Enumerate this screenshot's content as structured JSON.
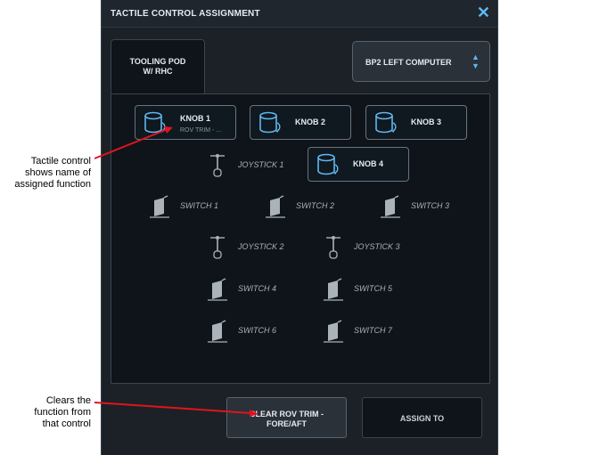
{
  "annotations": {
    "tactile_note": [
      "Tactile control",
      "shows name of",
      "assigned function"
    ],
    "clear_note": [
      "Clears the",
      "function from",
      "that control"
    ]
  },
  "dialog": {
    "title": "TACTILE CONTROL ASSIGNMENT",
    "close_icon": "close-icon",
    "tab": {
      "line1": "TOOLING POD",
      "line2": "W/ RHC"
    },
    "computer_select": {
      "value": "BP2 LEFT COMPUTER",
      "icon": "up-down-chevron-icon"
    },
    "knobs": [
      {
        "label": "KNOB 1",
        "assigned": "ROV TRIM - ...",
        "icon": "knob-icon"
      },
      {
        "label": "KNOB 2",
        "icon": "knob-icon"
      },
      {
        "label": "KNOB 3",
        "icon": "knob-icon"
      },
      {
        "label": "KNOB 4",
        "icon": "knob-icon"
      }
    ],
    "joysticks": [
      "JOYSTICK 1",
      "JOYSTICK 2",
      "JOYSTICK 3"
    ],
    "switches": [
      "SWITCH 1",
      "SWITCH 2",
      "SWITCH 3",
      "SWITCH 4",
      "SWITCH 5",
      "SWITCH 6",
      "SWITCH 7"
    ],
    "buttons": {
      "clear_line1": "CLEAR ROV TRIM -",
      "clear_line2": "FORE/AFT",
      "assign": "ASSIGN TO"
    }
  },
  "colors": {
    "accent": "#5fb8f0",
    "annotation_arrow": "#e0141e",
    "panel_bg": "#1b2127",
    "area_bg": "#0e141a"
  }
}
